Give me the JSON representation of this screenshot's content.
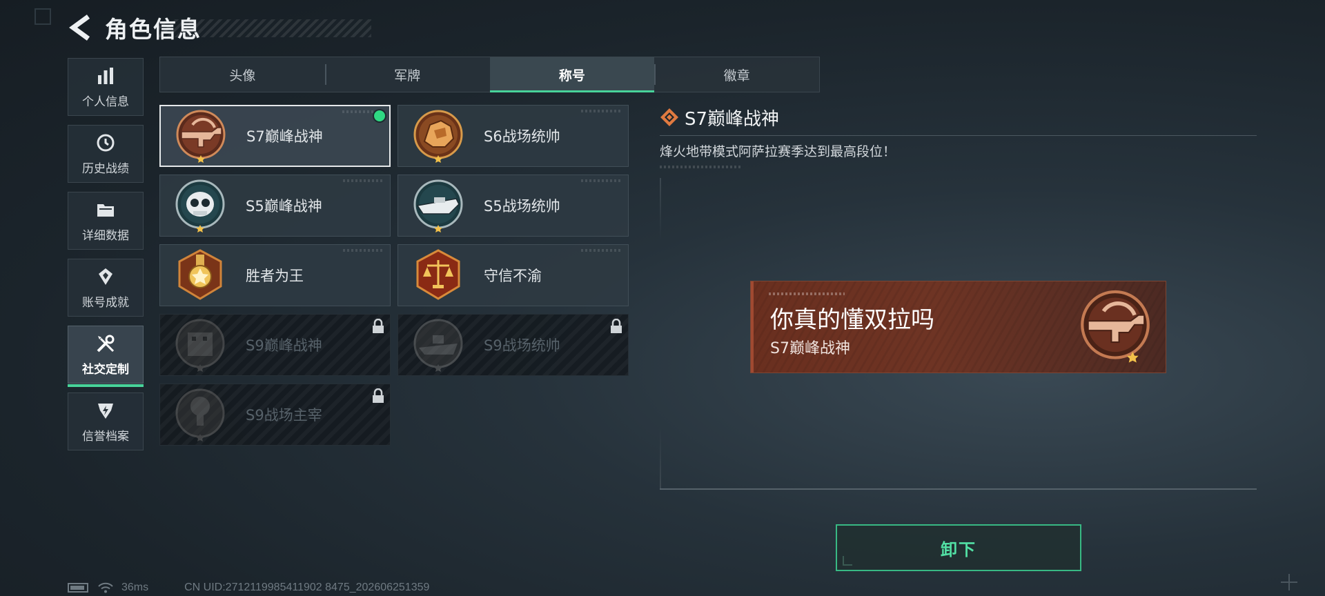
{
  "header": {
    "title": "角色信息"
  },
  "sidebar": {
    "items": [
      {
        "label": "个人信息",
        "icon": "bar-chart-icon"
      },
      {
        "label": "历史战绩",
        "icon": "history-clock-icon"
      },
      {
        "label": "详细数据",
        "icon": "folder-icon"
      },
      {
        "label": "账号成就",
        "icon": "achievement-icon"
      },
      {
        "label": "社交定制",
        "icon": "wrench-screwdriver-icon",
        "active": true
      },
      {
        "label": "信誉档案",
        "icon": "shield-lightning-icon"
      }
    ]
  },
  "tabs": [
    {
      "label": "头像"
    },
    {
      "label": "军牌"
    },
    {
      "label": "称号",
      "active": true
    },
    {
      "label": "徽章"
    }
  ],
  "titles": [
    {
      "name": "S7巅峰战神",
      "badge": "rifle-emblem-icon",
      "state": "equipped",
      "color": "#b8553a"
    },
    {
      "name": "S6战场统帅",
      "badge": "mech-emblem-icon",
      "state": "unlocked",
      "color": "#b8642a"
    },
    {
      "name": "S5巅峰战神",
      "badge": "skull-emblem-icon",
      "state": "unlocked",
      "color": "#2f6f78"
    },
    {
      "name": "S5战场统帅",
      "badge": "boat-emblem-icon",
      "state": "unlocked",
      "color": "#2f6f78"
    },
    {
      "name": "胜者为王",
      "badge": "medal-emblem-icon",
      "state": "unlocked",
      "color": "#b8542a"
    },
    {
      "name": "守信不渝",
      "badge": "scales-emblem-icon",
      "state": "unlocked",
      "color": "#a8361f"
    },
    {
      "name": "S9巅峰战神",
      "badge": "building-emblem-icon",
      "state": "locked",
      "color": "#6a5a4a"
    },
    {
      "name": "S9战场统帅",
      "badge": "warship-emblem-icon",
      "state": "locked",
      "color": "#5a5a52"
    },
    {
      "name": "S9战场主宰",
      "badge": "explosion-emblem-icon",
      "state": "locked",
      "color": "#6a5a4a"
    }
  ],
  "detail": {
    "title": "S7巅峰战神",
    "description": "烽火地带模式阿萨拉赛季达到最高段位！",
    "preview": {
      "nickname": "你真的懂双拉吗",
      "title": "S7巅峰战神"
    },
    "unequip_label": "卸下"
  },
  "status": {
    "ping": "36ms",
    "uid": "CN UID:2712119985411902 8475_202606251359"
  },
  "colors": {
    "accent_green": "#48d39a",
    "nameplate": "#6e3424"
  }
}
